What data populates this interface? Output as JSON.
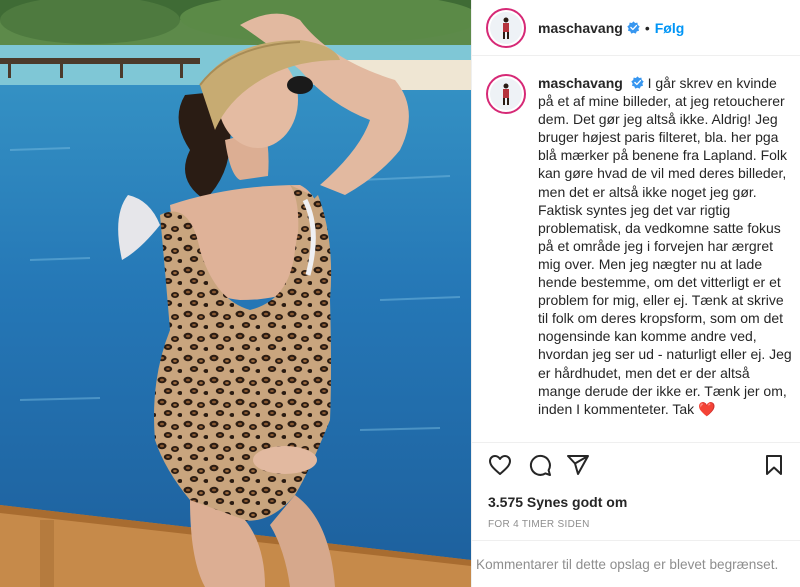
{
  "header": {
    "username": "maschavang",
    "separator": "•",
    "follow_label": "Følg"
  },
  "caption": {
    "username": "maschavang",
    "text": "I går skrev en kvinde på et af mine billeder, at jeg retoucherer dem. Det gør jeg altså ikke. Aldrig! Jeg bruger højest paris filteret, bla. her pga blå mærker på benene fra Lapland. Folk kan gøre hvad de vil med deres billeder, men det er altså ikke noget jeg gør. Faktisk syntes jeg det var rigtig problematisk, da vedkomne satte fokus på et område jeg i forvejen har ærgret mig over. Men jeg nægter nu at lade hende bestemme, om det vitterligt er et problem for mig, eller ej. Tænk at skrive til folk om deres kropsform, som om det nogensinde kan komme andre ved, hvordan jeg ser ud - naturligt eller ej. Jeg er hårdhudet, men det er der altså mange derude der ikke er. Tænk jer om, inden I kommenteter. Tak ❤️"
  },
  "stats": {
    "likes": "3.575 Synes godt om",
    "time": "FOR 4 TIMER SIDEN"
  },
  "comments": {
    "disabled_text": "Kommentarer til dette opslag er blevet begrænset."
  },
  "icons": {
    "like": "heart-icon",
    "comment": "comment-icon",
    "share": "share-icon",
    "save": "bookmark-icon",
    "verified": "verified-badge-icon"
  },
  "colors": {
    "link_blue": "#0095f6",
    "verified_blue": "#3897f0",
    "text": "#262626",
    "muted": "#8e8e8e",
    "heart_red": "#e0245e"
  }
}
